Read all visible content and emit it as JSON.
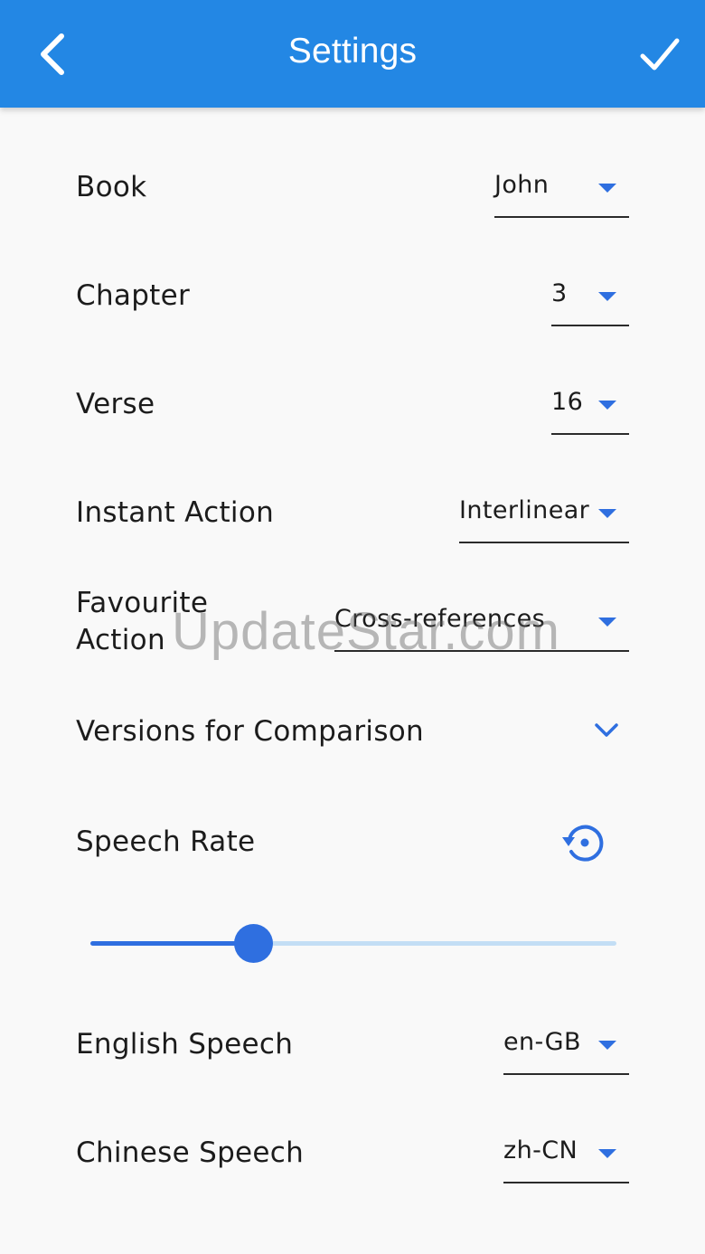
{
  "header": {
    "title": "Settings",
    "back_icon": "chevron-left-icon",
    "confirm_icon": "check-icon",
    "color": "#2387e4"
  },
  "settings": {
    "book": {
      "label": "Book",
      "value": "John"
    },
    "chapter": {
      "label": "Chapter",
      "value": "3"
    },
    "verse": {
      "label": "Verse",
      "value": "16"
    },
    "instant_action": {
      "label": "Instant Action",
      "value": "Interlinear"
    },
    "favourite_action": {
      "label_line1": "Favourite",
      "label_line2": "Action",
      "value": "Cross-references"
    },
    "versions": {
      "label": "Versions for Comparison",
      "icon": "chevron-down-icon"
    },
    "speech_rate": {
      "label": "Speech Rate",
      "icon": "reset-icon",
      "level_fraction": 0.31
    },
    "english_speech": {
      "label": "English Speech",
      "value": "en-GB"
    },
    "chinese_speech": {
      "label": "Chinese Speech",
      "value": "zh-CN"
    }
  },
  "watermark": "UpdateStar.com",
  "colors": {
    "accent": "#2f6fe0",
    "slider_inactive": "#c3def5",
    "text": "#1c1c1c",
    "background": "#f9f9f9"
  }
}
